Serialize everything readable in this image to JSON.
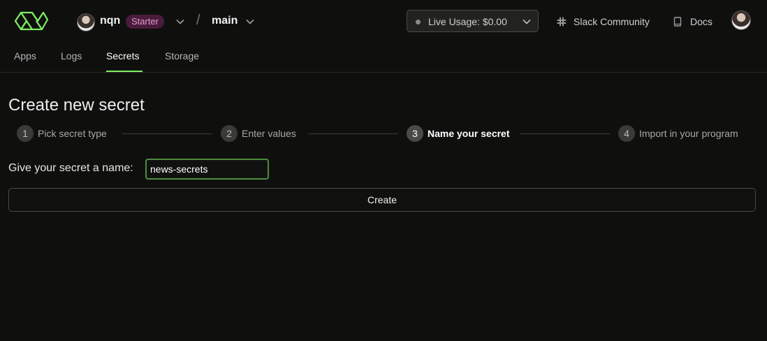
{
  "header": {
    "workspace": {
      "name": "nqn",
      "plan_badge": "Starter"
    },
    "separator": "/",
    "environment": "main",
    "live_usage": "Live Usage: $0.00",
    "slack_link": "Slack Community",
    "docs_link": "Docs"
  },
  "tabs": [
    {
      "label": "Apps",
      "active": false
    },
    {
      "label": "Logs",
      "active": false
    },
    {
      "label": "Secrets",
      "active": true
    },
    {
      "label": "Storage",
      "active": false
    }
  ],
  "page": {
    "title": "Create new secret",
    "steps": [
      {
        "number": "1",
        "label": "Pick secret type",
        "active": false
      },
      {
        "number": "2",
        "label": "Enter values",
        "active": false
      },
      {
        "number": "3",
        "label": "Name your secret",
        "active": true
      },
      {
        "number": "4",
        "label": "Import in your program",
        "active": false
      }
    ],
    "name_prompt": "Give your secret a name:",
    "name_value": "news-secrets",
    "create_label": "Create"
  },
  "colors": {
    "accent": "#7fee64",
    "badge_bg": "#4a1c3c",
    "badge_text": "#e39bd0",
    "background": "#0f100e"
  }
}
